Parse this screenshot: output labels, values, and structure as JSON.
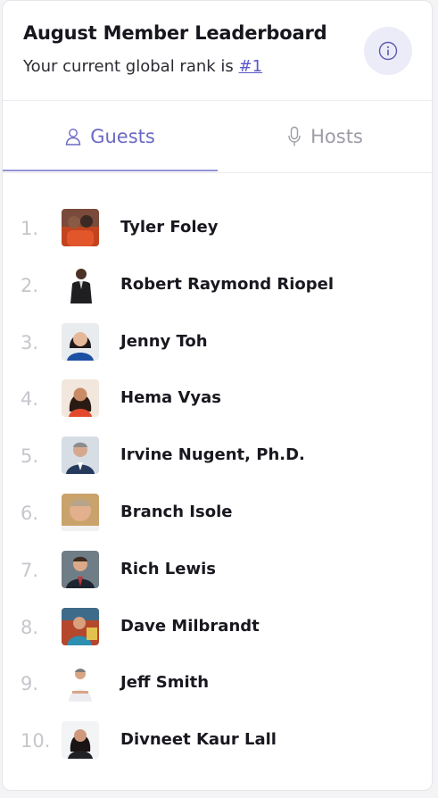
{
  "header": {
    "title": "August Member Leaderboard",
    "subtitle_prefix": "Your current global rank is ",
    "rank_link": "#1"
  },
  "tabs": [
    {
      "label": "Guests",
      "icon": "user-icon",
      "active": true
    },
    {
      "label": "Hosts",
      "icon": "microphone-icon",
      "active": false
    }
  ],
  "leaderboard": [
    {
      "rank": "1.",
      "name": "Tyler Foley"
    },
    {
      "rank": "2.",
      "name": "Robert Raymond Riopel"
    },
    {
      "rank": "3.",
      "name": "Jenny Toh"
    },
    {
      "rank": "4.",
      "name": "Hema Vyas"
    },
    {
      "rank": "5.",
      "name": "Irvine Nugent, Ph.D."
    },
    {
      "rank": "6.",
      "name": "Branch Isole"
    },
    {
      "rank": "7.",
      "name": "Rich Lewis"
    },
    {
      "rank": "8.",
      "name": "Dave Milbrandt"
    },
    {
      "rank": "9.",
      "name": "Jeff Smith"
    },
    {
      "rank": "10.",
      "name": "Divneet Kaur Lall"
    }
  ],
  "colors": {
    "accent": "#6b69c4",
    "tab_underline": "#9493d6",
    "info_bg": "#ececf8"
  }
}
